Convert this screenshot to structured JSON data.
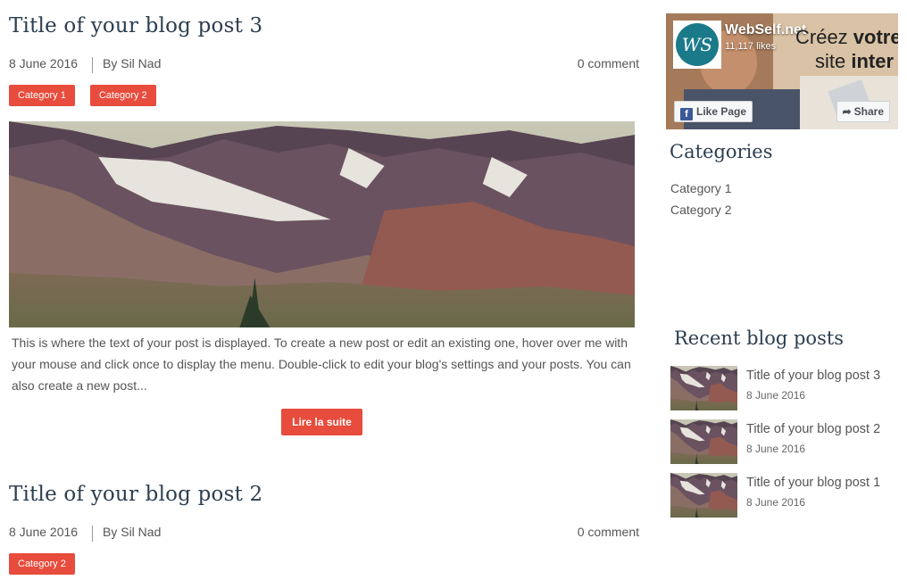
{
  "posts": [
    {
      "title": "Title of your blog post 3",
      "date": "8 June 2016",
      "author": "By Sil Nad",
      "comments": "0 comment",
      "categories": [
        "Category 1",
        "Category 2"
      ],
      "excerpt": "This is where the text of your post is displayed. To create a new post or edit an existing one, hover over me with your mouse and click once to display the menu. Double-click to edit your blog's settings and your posts. You can also create a new post...",
      "read_more": "Lire la suite"
    },
    {
      "title": "Title of your blog post 2",
      "date": "8 June 2016",
      "author": "By Sil Nad",
      "comments": "0 comment",
      "categories": [
        "Category 2"
      ]
    }
  ],
  "facebook": {
    "name": "WebSelf.net",
    "likes": "11,117 likes",
    "logo_text": "WS",
    "tagline_line1": "Créez votre",
    "tagline_line2": "site inter",
    "like_button": "Like Page",
    "share_button": "Share"
  },
  "sidebar": {
    "categories_heading": "Categories",
    "categories": [
      "Category 1",
      "Category 2"
    ],
    "recent_heading": "Recent blog posts",
    "recent": [
      {
        "title": "Title of your blog post 3",
        "date": "8 June 2016"
      },
      {
        "title": "Title of your blog post 2",
        "date": "8 June 2016"
      },
      {
        "title": "Title of your blog post 1",
        "date": "8 June 2016"
      }
    ]
  },
  "colors": {
    "accent": "#e74c3c",
    "heading": "#2c3e50",
    "facebook_blue": "#3b5998"
  },
  "icons": {
    "facebook": "facebook-f-icon",
    "share": "share-arrow-icon"
  }
}
